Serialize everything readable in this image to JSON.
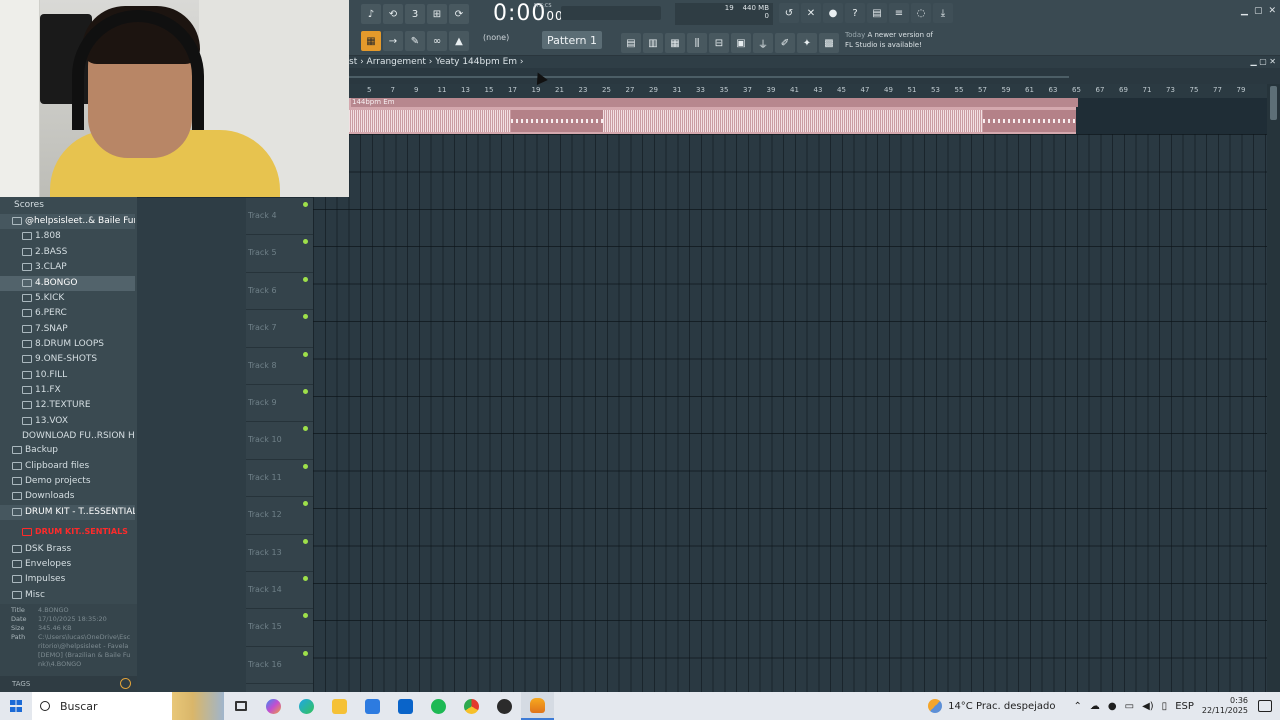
{
  "toolbar": {
    "time": "0:00",
    "time_sub": "00",
    "time_unit_label": "M:S:CS",
    "cpu_value": "19",
    "memory": "440 MB",
    "cpu_zero": "0",
    "pattern_none": "(none)",
    "pattern": "Pattern 1",
    "update_today": "Today",
    "update_message_1": "A newer version of",
    "update_message_2": "FL Studio is available!"
  },
  "arrangement": {
    "breadcrumb": "st › Arrangement › Yeaty 144bpm Em ›",
    "clip_title": "144bpm Em",
    "ruler_marks": [
      "5",
      "7",
      "9",
      "11",
      "13",
      "15",
      "17",
      "19",
      "21",
      "23",
      "25",
      "27",
      "29",
      "31",
      "33",
      "35",
      "37",
      "39",
      "41",
      "43",
      "45",
      "47",
      "49",
      "51",
      "53",
      "55",
      "57",
      "59",
      "61",
      "63",
      "65",
      "67",
      "69",
      "71",
      "73",
      "75",
      "77",
      "79"
    ]
  },
  "tracks": [
    "Track 4",
    "Track 5",
    "Track 6",
    "Track 7",
    "Track 8",
    "Track 9",
    "Track 10",
    "Track 11",
    "Track 12",
    "Track 13",
    "Track 14",
    "Track 15",
    "Track 16"
  ],
  "browser": {
    "items": [
      {
        "label": "Scores",
        "type": "plain"
      },
      {
        "label": "@helpsisleet..& Baile Funk)",
        "type": "folder sel"
      },
      {
        "label": "1.808",
        "type": "folder sub"
      },
      {
        "label": "2.BASS",
        "type": "folder sub"
      },
      {
        "label": "3.CLAP",
        "type": "folder sub"
      },
      {
        "label": "4.BONGO",
        "type": "folder sub hl"
      },
      {
        "label": "5.KICK",
        "type": "folder sub"
      },
      {
        "label": "6.PERC",
        "type": "folder sub"
      },
      {
        "label": "7.SNAP",
        "type": "folder sub"
      },
      {
        "label": "8.DRUM LOOPS",
        "type": "folder sub"
      },
      {
        "label": "9.ONE-SHOTS",
        "type": "folder sub"
      },
      {
        "label": "10.FILL",
        "type": "folder sub"
      },
      {
        "label": "11.FX",
        "type": "folder sub"
      },
      {
        "label": "12.TEXTURE",
        "type": "folder sub"
      },
      {
        "label": "13.VOX",
        "type": "folder sub"
      },
      {
        "label": "DOWNLOAD FU..RSION HERE",
        "type": "file sub"
      },
      {
        "label": "Backup",
        "type": "folder"
      },
      {
        "label": "Clipboard files",
        "type": "folder"
      },
      {
        "label": "Demo projects",
        "type": "folder"
      },
      {
        "label": "Downloads",
        "type": "folder"
      },
      {
        "label": "DRUM KIT - T..ESSENTIALS",
        "type": "folder sel"
      },
      {
        "label": "DRUM KIT..SENTIALS",
        "type": "folder sub red"
      },
      {
        "label": "DSK Brass",
        "type": "folder"
      },
      {
        "label": "Envelopes",
        "type": "folder"
      },
      {
        "label": "Impulses",
        "type": "folder"
      },
      {
        "label": "Misc",
        "type": "folder"
      }
    ],
    "info": {
      "title_key": "Title",
      "title_val": "4.BONGO",
      "date_key": "Date",
      "date_val": "17/10/2025 18:35:20",
      "size_key": "Size",
      "size_val": "345.46 KB",
      "path_key": "Path",
      "path_val": "C:\\Users\\lucas\\OneDrive\\Escritorio\\@helpsisleet - Favela [DEMO] (Brazilian & Baile Funk)\\4.BONGO"
    },
    "tags_label": "TAGS"
  },
  "taskbar": {
    "search_label": "Buscar",
    "weather": "14°C  Prac. despejado",
    "language": "ESP",
    "time": "0:36",
    "date": "22/11/2025"
  },
  "colors": {
    "clip": "#d4a8ae",
    "track_dot": "#9ee04a",
    "red_label": "#ff2a2a"
  }
}
